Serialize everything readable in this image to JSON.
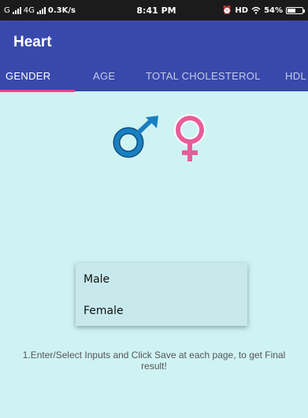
{
  "status_bar": {
    "carrier": "G",
    "network": "4G",
    "speed": "0.3K/s",
    "time": "8:41 PM",
    "indicators": "HD",
    "battery": "54%",
    "battery_level": 0.54
  },
  "app": {
    "title": "Heart"
  },
  "tabs": [
    {
      "label": "GENDER",
      "active": true
    },
    {
      "label": "AGE",
      "active": false
    },
    {
      "label": "TOTAL CHOLESTEROL",
      "active": false
    },
    {
      "label": "HDL",
      "active": false
    }
  ],
  "colors": {
    "appbar": "#3949ab",
    "accent": "#ff4081",
    "background": "#cff3f3",
    "male_symbol": "#1a7fc1",
    "female_symbol": "#e85c9a"
  },
  "icons": [
    "male-symbol-icon",
    "female-symbol-icon"
  ],
  "gender_menu": {
    "options": [
      "Male",
      "Female"
    ]
  },
  "hint": "1.Enter/Select Inputs and Click Save at each page, to get Final result!"
}
